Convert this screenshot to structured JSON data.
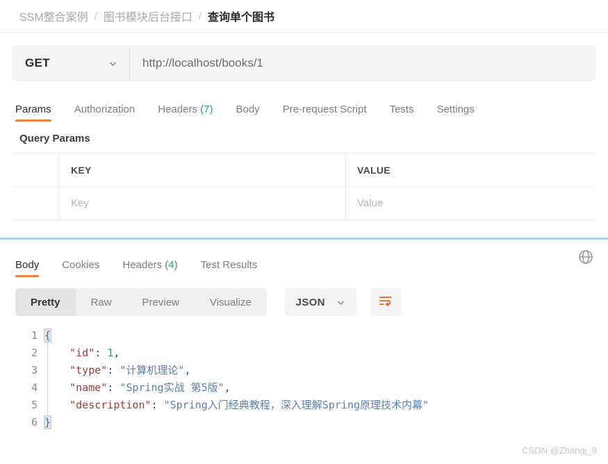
{
  "breadcrumb": {
    "items": [
      {
        "label": "SSM整合案例",
        "current": false
      },
      {
        "label": "图书模块后台接口",
        "current": false
      },
      {
        "label": "查询单个图书",
        "current": true
      }
    ],
    "separator": "/"
  },
  "request": {
    "method": "GET",
    "url": "http://localhost/books/1",
    "tabs": [
      {
        "label": "Params",
        "count": "",
        "active": true
      },
      {
        "label": "Authorization",
        "count": "",
        "active": false
      },
      {
        "label": "Headers",
        "count": "(7)",
        "active": false
      },
      {
        "label": "Body",
        "count": "",
        "active": false
      },
      {
        "label": "Pre-request Script",
        "count": "",
        "active": false
      },
      {
        "label": "Tests",
        "count": "",
        "active": false
      },
      {
        "label": "Settings",
        "count": "",
        "active": false
      }
    ],
    "params_section_title": "Query Params",
    "table": {
      "headers": {
        "key": "KEY",
        "value": "VALUE"
      },
      "placeholder_row": {
        "key": "Key",
        "value": "Value"
      }
    }
  },
  "response": {
    "tabs": [
      {
        "label": "Body",
        "count": "",
        "active": true
      },
      {
        "label": "Cookies",
        "count": "",
        "active": false
      },
      {
        "label": "Headers",
        "count": "(4)",
        "active": false
      },
      {
        "label": "Test Results",
        "count": "",
        "active": false
      }
    ],
    "globe_icon": "globe-icon",
    "format_tabs": [
      {
        "label": "Pretty",
        "active": true
      },
      {
        "label": "Raw",
        "active": false
      },
      {
        "label": "Preview",
        "active": false
      },
      {
        "label": "Visualize",
        "active": false
      }
    ],
    "language": "JSON",
    "wrap_icon": "wrap-text-icon",
    "body": {
      "line_numbers": [
        "1",
        "2",
        "3",
        "4",
        "5",
        "6"
      ],
      "open_brace": "{",
      "close_brace": "}",
      "fields": [
        {
          "key": "\"id\"",
          "value": "1",
          "type": "number",
          "comma": ","
        },
        {
          "key": "\"type\"",
          "value": "\"计算机理论\"",
          "type": "string",
          "comma": ","
        },
        {
          "key": "\"name\"",
          "value": "\"Spring实战 第5版\"",
          "type": "string",
          "comma": ","
        },
        {
          "key": "\"description\"",
          "value": "\"Spring入门经典教程，深入理解Spring原理技术内幕\"",
          "type": "string",
          "comma": ""
        }
      ]
    }
  },
  "watermark": "CSDN @Zhangj_9",
  "colors": {
    "accent_orange": "#f0803c",
    "count_teal": "#2aa079",
    "divider_blue": "#a9d2ef"
  }
}
